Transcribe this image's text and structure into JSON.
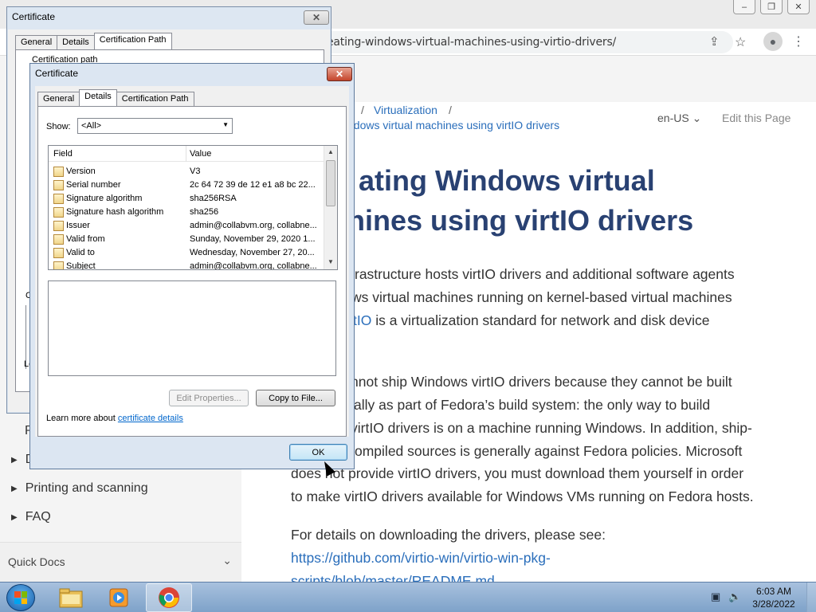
{
  "browser": {
    "url": "eating-windows-virtual-machines-using-virtio-drivers/",
    "window_controls": [
      "–",
      "❐",
      "✕"
    ],
    "breadcrumb": {
      "sep1": "/",
      "virtualization": "Virtualization",
      "sep2": "/",
      "current": "ndows virtual machines using virtIO drivers"
    },
    "language": "en-US",
    "edit_page": "Edit this Page",
    "title_line1": "ating Windows virtual",
    "title_line2": "hines using virtIO drivers",
    "paragraph1": {
      "line1": "rastructure hosts virtIO drivers and additional software agents",
      "line2": "ws virtual machines running on kernel-based virtual machines",
      "link": "tIO",
      "line3_rest": " is a virtualization standard for network and disk device"
    },
    "paragraph2": {
      "line1": "nnot ship Windows virtIO drivers because they cannot be built",
      "line2": "ally as part of Fedora’s build system: the only way to build",
      "line3": "virtIO drivers is on a machine running Windows. In addition, ship-",
      "line4": "ompiled sources is generally against Fedora policies. Microsoft",
      "line5": "does not provide virtIO drivers, you must download them yourself in order",
      "line6": "to make virtIO drivers available for Windows VMs running on Fedora hosts."
    },
    "paragraph3": {
      "line1": "For details on downloading the drivers, please see:",
      "link_line1": "https://github.com/virtio-win/virtio-win-pkg-",
      "link_line2": "scripts/blob/master/README.md"
    },
    "nav": {
      "item_p": "P",
      "item_d": "D",
      "printing": "Printing and scanning",
      "faq": "FAQ",
      "quick_docs": "Quick Docs"
    }
  },
  "cert_back": {
    "title": "Certificate",
    "close": "✕",
    "tabs": [
      "General",
      "Details",
      "Certification Path"
    ],
    "partial_text": "Certification path",
    "partial_c": "C",
    "partial_le": "Le"
  },
  "cert_front": {
    "title": "Certificate",
    "close": "✕",
    "tabs": [
      "General",
      "Details",
      "Certification Path"
    ],
    "show_label": "Show:",
    "show_value": "<All>",
    "columns": {
      "field": "Field",
      "value": "Value"
    },
    "rows": [
      {
        "field": "Version",
        "value": "V3"
      },
      {
        "field": "Serial number",
        "value": "2c 64 72 39 de 12 e1 a8 bc 22..."
      },
      {
        "field": "Signature algorithm",
        "value": "sha256RSA"
      },
      {
        "field": "Signature hash algorithm",
        "value": "sha256"
      },
      {
        "field": "Issuer",
        "value": "admin@collabvm.org, collabne..."
      },
      {
        "field": "Valid from",
        "value": "Sunday, November 29, 2020 1..."
      },
      {
        "field": "Valid to",
        "value": "Wednesday, November 27, 20..."
      },
      {
        "field": "Subject",
        "value": "admin@collabvm.org, collabne..."
      }
    ],
    "edit_properties": "Edit Properties...",
    "copy_to_file": "Copy to File...",
    "learn_more": "Learn more about ",
    "learn_more_link": "certificate details",
    "ok": "OK"
  },
  "taskbar": {
    "time": "6:03 AM",
    "date": "3/28/2022"
  }
}
